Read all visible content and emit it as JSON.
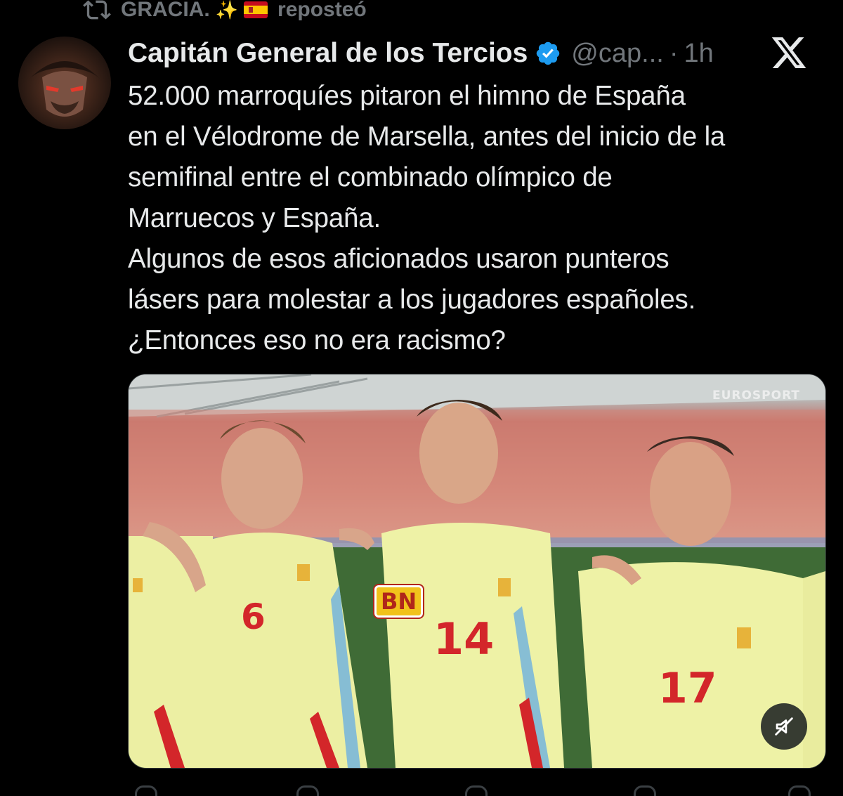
{
  "repost": {
    "user": "GRACIA.",
    "action": "reposteó"
  },
  "tweet": {
    "author_name": "Capitán General de los Tercios",
    "handle": "@cap...",
    "separator": "·",
    "time": "1h",
    "text_lines": [
      "52.000 marroquíes pitaron el himno de España",
      "en el Vélodrome de Marsella, antes del inicio de la",
      "semifinal entre el combinado olímpico de",
      "Marruecos y España.",
      "Algunos de esos aficionados usaron punteros",
      "lásers para molestar a los jugadores españoles.",
      "¿Entonces eso no era racismo?"
    ]
  },
  "media": {
    "watermark": "EUROSPORT",
    "overlay_badge": "BN",
    "jersey_numbers": [
      "6",
      "14",
      "17"
    ],
    "mute_state": "muted"
  },
  "icons": {
    "repost": "repost-icon",
    "verified": "verified-badge-icon",
    "platform": "x-logo-icon",
    "mute": "muted-speaker-icon"
  },
  "colors": {
    "background": "#000000",
    "text": "#e7e9ea",
    "secondary": "#71767b",
    "verified": "#1d9bf0",
    "jersey": "#eef0a0",
    "jersey_trim": "#d3262a"
  }
}
